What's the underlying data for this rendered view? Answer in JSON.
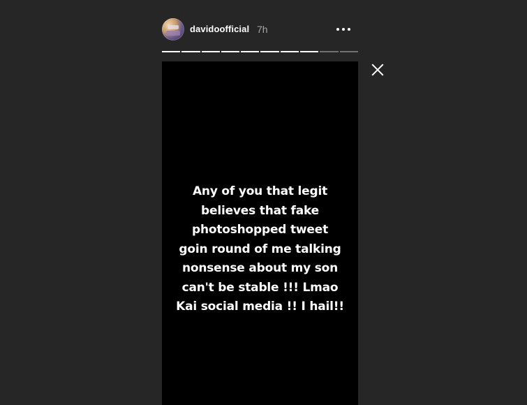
{
  "header": {
    "username": "davidoofficial",
    "timestamp": "7h",
    "avatar_icon": "profile-avatar-icon",
    "more_icon": "more-options-icon"
  },
  "progress": {
    "segments_total": 10,
    "segments_complete": 8
  },
  "close_icon": "close-icon",
  "story": {
    "background_color": "#000000",
    "text": "Any of you that legit\nbelieves that fake\nphotoshopped tweet\ngoin round of me talking\nnonsense about my son\ncan't be stable !!! Lmao\nKai social media !! I hail!!"
  },
  "colors": {
    "page_background": "#262626",
    "timestamp": "#a8a8a8",
    "text": "#ffffff"
  }
}
